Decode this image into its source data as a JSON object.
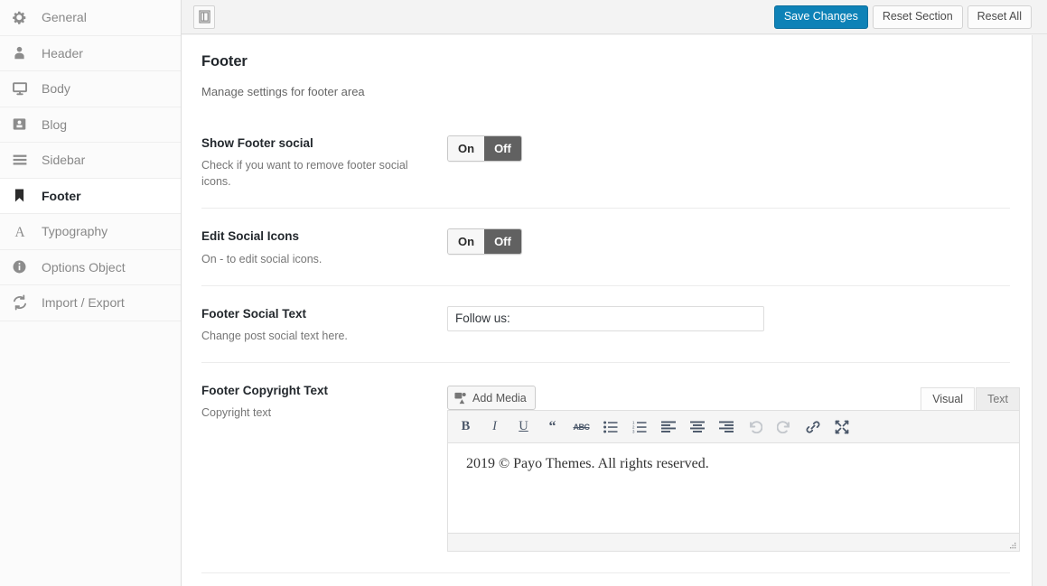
{
  "sidebar": {
    "items": [
      {
        "label": "General",
        "icon": "gear-icon",
        "active": false
      },
      {
        "label": "Header",
        "icon": "user-icon",
        "active": false
      },
      {
        "label": "Body",
        "icon": "monitor-icon",
        "active": false
      },
      {
        "label": "Blog",
        "icon": "blog-icon",
        "active": false
      },
      {
        "label": "Sidebar",
        "icon": "menu-lines-icon",
        "active": false
      },
      {
        "label": "Footer",
        "icon": "bookmark-icon",
        "active": true
      },
      {
        "label": "Typography",
        "icon": "letter-a-icon",
        "active": false
      },
      {
        "label": "Options Object",
        "icon": "info-icon",
        "active": false
      },
      {
        "label": "Import / Export",
        "icon": "sync-icon",
        "active": false
      }
    ]
  },
  "topbar": {
    "layout_toggle_icon": "layout-panel-icon",
    "save_label": "Save Changes",
    "reset_section_label": "Reset Section",
    "reset_all_label": "Reset All",
    "primary_color": "#0e82b7"
  },
  "section": {
    "title": "Footer",
    "subtitle": "Manage settings for footer area"
  },
  "fields": {
    "show_footer_social": {
      "title": "Show Footer social",
      "desc": "Check if you want to remove footer social icons.",
      "toggle_on_label": "On",
      "toggle_off_label": "Off",
      "value": "Off"
    },
    "edit_social_icons": {
      "title": "Edit Social Icons",
      "desc": "On - to edit social icons.",
      "toggle_on_label": "On",
      "toggle_off_label": "Off",
      "value": "Off"
    },
    "footer_social_text": {
      "title": "Footer Social Text",
      "desc": "Change post social text here.",
      "value": "Follow us:",
      "placeholder": ""
    },
    "footer_copyright_text": {
      "title": "Footer Copyright Text",
      "desc": "Copyright text",
      "add_media_label": "Add Media",
      "tab_visual": "Visual",
      "tab_text": "Text",
      "active_tab": "Visual",
      "content": "2019 © Payo Themes. All rights reserved.",
      "toolbar": [
        {
          "name": "bold-icon",
          "glyph": "B",
          "disabled": false
        },
        {
          "name": "italic-icon",
          "glyph": "I",
          "disabled": false
        },
        {
          "name": "underline-icon",
          "glyph": "U",
          "disabled": false
        },
        {
          "name": "blockquote-icon",
          "glyph": "“",
          "disabled": false
        },
        {
          "name": "strikethrough-icon",
          "glyph": "ABC",
          "disabled": false
        },
        {
          "name": "bullet-list-icon",
          "glyph": "",
          "disabled": false
        },
        {
          "name": "numbered-list-icon",
          "glyph": "",
          "disabled": false
        },
        {
          "name": "align-left-icon",
          "glyph": "",
          "disabled": false
        },
        {
          "name": "align-center-icon",
          "glyph": "",
          "disabled": false
        },
        {
          "name": "align-right-icon",
          "glyph": "",
          "disabled": false
        },
        {
          "name": "undo-icon",
          "glyph": "",
          "disabled": true
        },
        {
          "name": "redo-icon",
          "glyph": "",
          "disabled": true
        },
        {
          "name": "link-icon",
          "glyph": "",
          "disabled": false
        },
        {
          "name": "fullscreen-icon",
          "glyph": "",
          "disabled": false
        }
      ]
    }
  }
}
